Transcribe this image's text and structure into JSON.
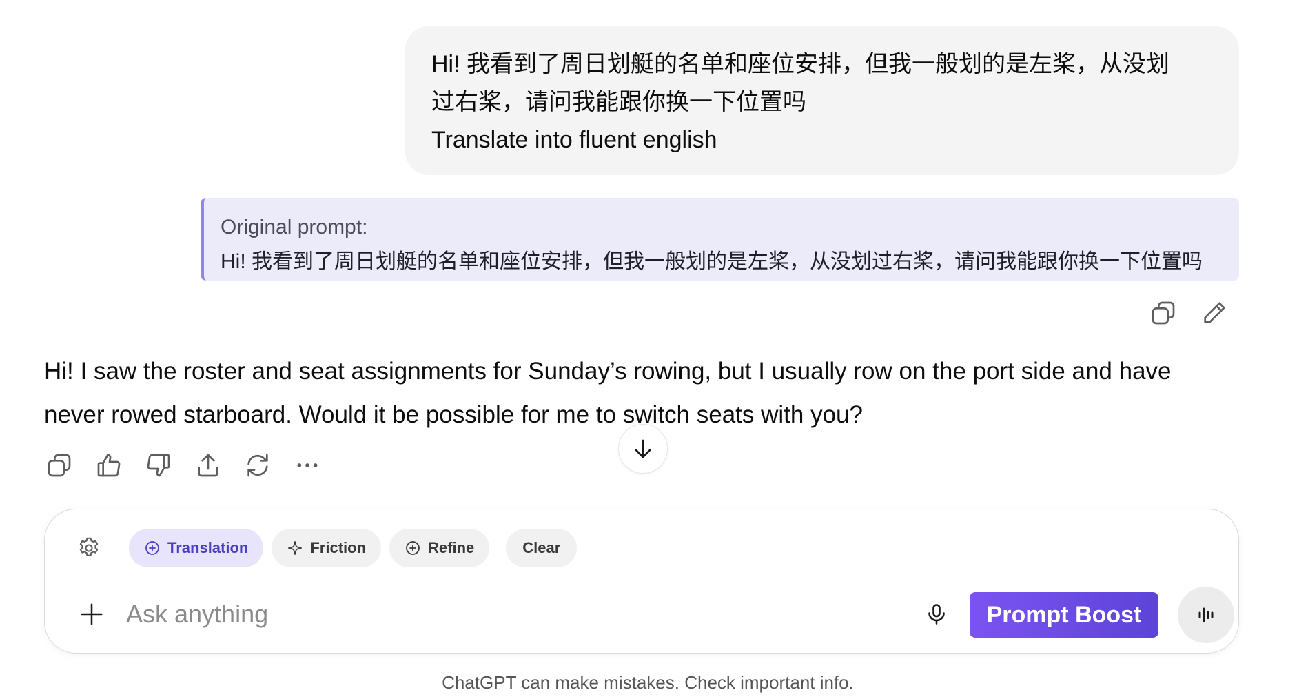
{
  "user_message": {
    "line1": "Hi! 我看到了周日划艇的名单和座位安排，但我一般划的是左桨，从没划",
    "line2": "过右桨，请问我能跟你换一下位置吗",
    "line3": "Translate into fluent english"
  },
  "original_prompt": {
    "label": "Original prompt:",
    "text": "Hi! 我看到了周日划艇的名单和座位安排，但我一般划的是左桨，从没划过右桨，请问我能跟你换一下位置吗"
  },
  "user_actions": {
    "icons": [
      "copy-icon",
      "edit-icon"
    ]
  },
  "assistant_reply": {
    "text": "Hi! I saw the roster and seat assignments for Sunday’s rowing, but I usually row on the port side and have never rowed starboard. Would it be possible for me to switch seats with you?"
  },
  "reply_actions": {
    "icons": [
      "copy-icon",
      "thumbs-up-icon",
      "thumbs-down-icon",
      "share-icon",
      "regenerate-icon",
      "more-icon"
    ]
  },
  "composer": {
    "chips": {
      "translation": "Translation",
      "friction": "Friction",
      "refine": "Refine",
      "clear": "Clear"
    },
    "placeholder": "Ask anything",
    "boost_label": "Prompt Boost"
  },
  "footer": {
    "disclaimer": "ChatGPT can make mistakes. Check important info."
  },
  "colors": {
    "accent": "#6b4cf0",
    "active_chip_bg": "#e7e4fb",
    "original_prompt_bar": "#8f86f0"
  }
}
